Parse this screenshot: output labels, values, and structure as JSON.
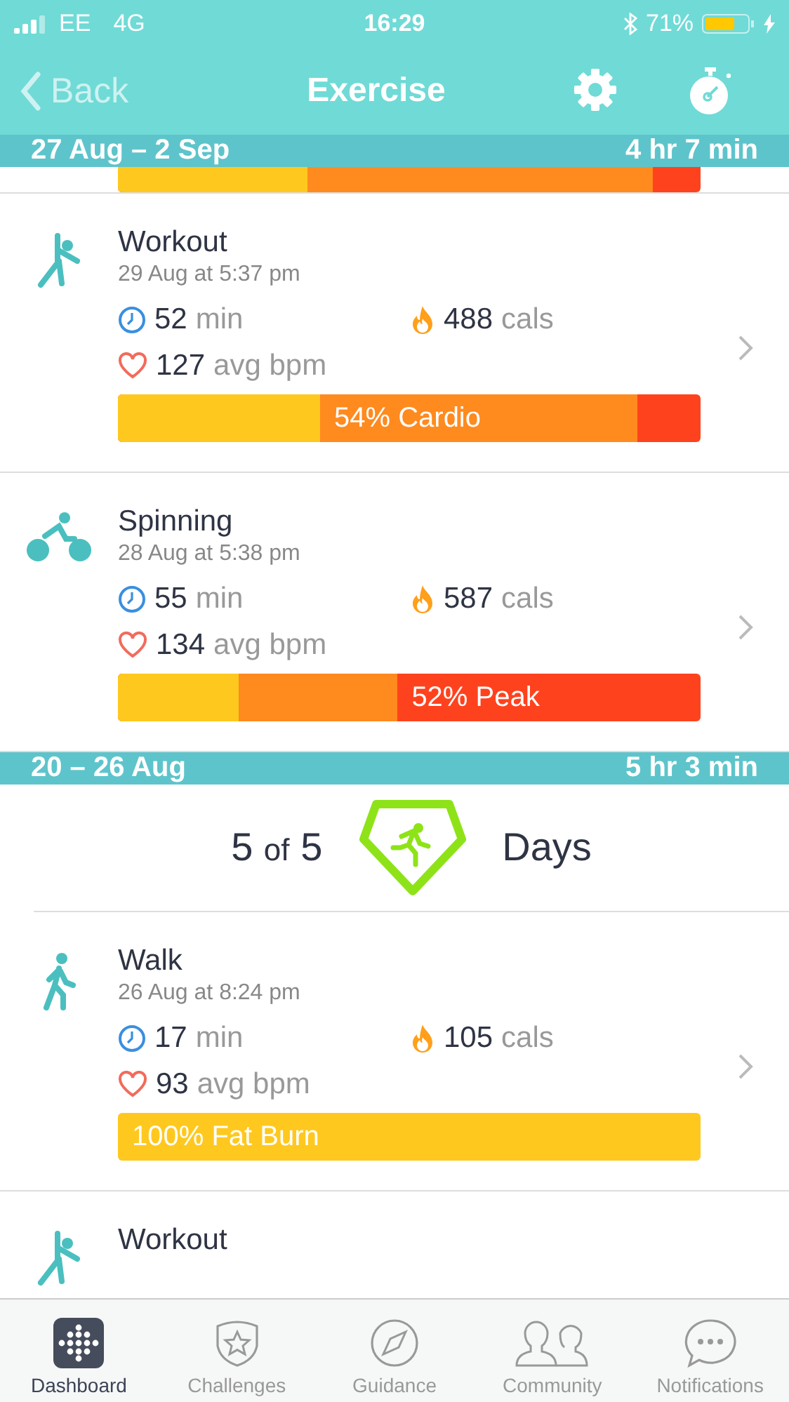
{
  "status_bar": {
    "carrier": "EE",
    "network": "4G",
    "time": "16:29",
    "battery": "71%"
  },
  "nav": {
    "back": "Back",
    "title": "Exercise"
  },
  "weeks": [
    {
      "range": "27 Aug – 2 Sep",
      "total": "4 hr 7 min",
      "partial_zones": [
        {
          "color": "#ffc81e",
          "level": 0.325
        },
        {
          "color": "#ff8a1e",
          "level": 0.918
        },
        {
          "color": "#ff421e"
        }
      ],
      "activities": [
        {
          "kind": "workout",
          "name": "Workout",
          "time": "29 Aug at 5:37 pm",
          "duration": "52",
          "duration_unit": "min",
          "calories": "488",
          "calories_unit": "cals",
          "heart_rate": "127",
          "heart_rate_unit": "avg bpm",
          "zones": [
            {
              "color": "#ffc81e",
              "level": 0.347
            },
            {
              "color": "#ff8a1e",
              "level": 0.892,
              "label": "54% Cardio"
            },
            {
              "color": "#ff421e"
            }
          ]
        },
        {
          "kind": "cycling",
          "name": "Spinning",
          "time": "28 Aug at 5:38 pm",
          "duration": "55",
          "duration_unit": "min",
          "calories": "587",
          "calories_unit": "cals",
          "heart_rate": "134",
          "heart_rate_unit": "avg bpm",
          "zones": [
            {
              "color": "#ffc81e",
              "level": 0.207
            },
            {
              "color": "#ff8a1e",
              "level": 0.48
            },
            {
              "color": "#ff421e",
              "label": "52% Peak"
            }
          ]
        }
      ]
    },
    {
      "range": "20 – 26 Aug",
      "total": "5 hr 3 min",
      "goal": {
        "count": "5",
        "of": "of",
        "target": "5",
        "unit": "Days"
      },
      "activities": [
        {
          "kind": "walk",
          "name": "Walk",
          "time": "26 Aug at 8:24 pm",
          "duration": "17",
          "duration_unit": "min",
          "calories": "105",
          "calories_unit": "cals",
          "heart_rate": "93",
          "heart_rate_unit": "avg bpm",
          "zones": [
            {
              "color": "#ffc81e",
              "label": "100% Fat Burn"
            }
          ]
        },
        {
          "kind": "workout",
          "name": "Workout"
        }
      ]
    }
  ],
  "tabs": [
    {
      "label": "Dashboard",
      "selected": true
    },
    {
      "label": "Challenges",
      "selected": false
    },
    {
      "label": "Guidance",
      "selected": false
    },
    {
      "label": "Community",
      "selected": false
    },
    {
      "label": "Notifications",
      "selected": false
    }
  ]
}
